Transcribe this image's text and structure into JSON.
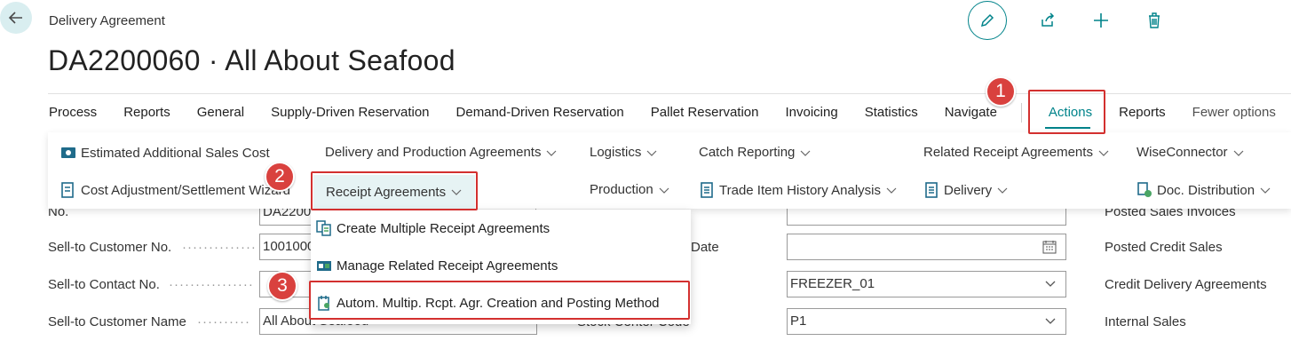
{
  "header": {
    "breadcrumb": "Delivery Agreement",
    "title": "DA2200060 · All About Seafood",
    "icons": [
      "back-arrow-icon",
      "edit-icon",
      "share-icon",
      "plus-icon",
      "trash-icon"
    ]
  },
  "tabs": [
    "Process",
    "Reports",
    "General",
    "Supply-Driven Reservation",
    "Demand-Driven Reservation",
    "Pallet Reservation",
    "Invoicing",
    "Statistics",
    "Navigate",
    "Actions",
    "Reports",
    "Fewer options"
  ],
  "action_panel": {
    "col1": [
      "Estimated Additional Sales Cost",
      "Cost Adjustment/Settlement Wizard"
    ],
    "col2": [
      "Delivery and Production Agreements",
      "Receipt Agreements"
    ],
    "col3": [
      "Logistics",
      "Production"
    ],
    "col4": [
      "Catch Reporting",
      "Trade Item History Analysis"
    ],
    "col5": [
      "Related Receipt Agreements",
      "Delivery"
    ],
    "col6": [
      "WiseConnector",
      "Doc. Distribution"
    ]
  },
  "dropdown": {
    "items": [
      "Create Multiple Receipt Agreements",
      "Manage Related Receipt Agreements",
      "Autom. Multip. Rcpt. Agr. Creation and Posting Method"
    ]
  },
  "background_form": {
    "labels": [
      "No.",
      "Sell-to Customer No.",
      "Sell-to Contact No.",
      "Sell-to Customer Name"
    ],
    "values": [
      "DA2200",
      "1001000",
      "",
      "All About Seafood"
    ],
    "mid_labels": [
      "Date",
      "Stock Center Code"
    ],
    "mid_values": [
      "",
      "FREEZER_01",
      "P1"
    ],
    "right_links": [
      "Posted Sales Invoices",
      "Posted Credit Sales",
      "Credit Delivery Agreements",
      "Internal Sales"
    ]
  },
  "annotations": [
    "1",
    "2",
    "3"
  ],
  "colors": {
    "accent": "#00838a",
    "highlight_box": "#d3302f",
    "badge": "#d9413e"
  }
}
